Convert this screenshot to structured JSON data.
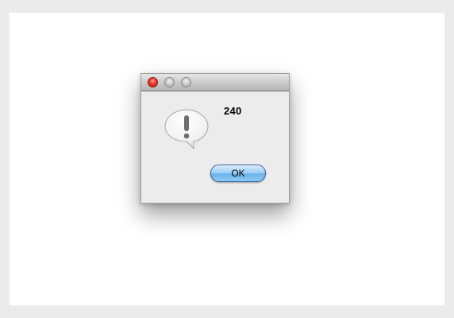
{
  "dialog": {
    "message": "240",
    "ok_label": "OK",
    "icon": "alert-exclamation-bubble",
    "window_controls": [
      "close",
      "minimize",
      "zoom"
    ]
  },
  "colors": {
    "close_button": "#e83a2b",
    "ok_button": "#8ccaf3",
    "dialog_background": "#ececec"
  }
}
